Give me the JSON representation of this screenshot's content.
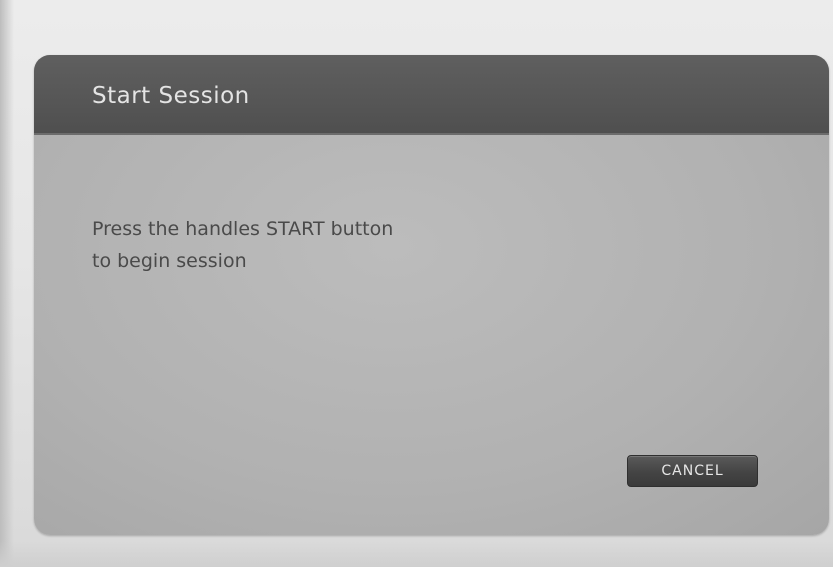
{
  "dialog": {
    "title": "Start Session",
    "message_lines": [
      "Press the handles START button",
      "to begin session"
    ],
    "cancel_label": "CANCEL"
  }
}
